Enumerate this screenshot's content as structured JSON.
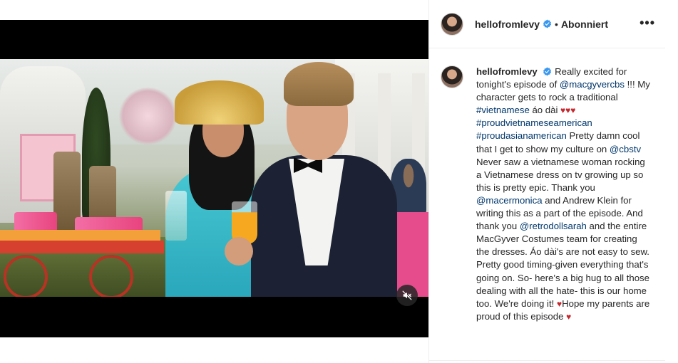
{
  "post": {
    "username": "hellofromlevy",
    "follow_status": "Abonniert",
    "more_label": "•••"
  },
  "caption": {
    "username": "hellofromlevy",
    "t1": "Really excited for tonight's episode of ",
    "m1": "@macgyvercbs",
    "t2": " !!! My character gets to rock a traditional ",
    "h1": "#vietnamese",
    "t3": " áo dài ",
    "hearts1": "♥♥♥",
    "h2": "#proudvietnameseamerican",
    "h3": "#proudasianamerican",
    "t4": " Pretty damn cool that I get to show my culture on ",
    "m2": "@cbstv",
    "t5": " Never saw a vietnamese woman rocking a Vietnamese dress on tv growing up so this is pretty epic. Thank you ",
    "m3": "@macermonica",
    "t6": " and Andrew Klein for writing this as a part of the episode. And thank you ",
    "m4": "@retrodollsarah",
    "t7": " and the entire MacGyver Costumes team for creating the dresses. Áo dài's are not easy to sew. Pretty good timing-given everything that's going on. So- here's a big hug to all those dealing with all the hate- this is our home too. We're doing it! ",
    "heart2": "♥",
    "t8": "Hope my parents are proud of this episode ",
    "heart3": "♥"
  },
  "colors": {
    "link": "#00376b",
    "verified": "#3897f0",
    "heart": "#c5272d"
  },
  "icons": {
    "mute": "speaker-muted-icon",
    "verified": "verified-badge-icon",
    "more": "more-options-icon"
  }
}
